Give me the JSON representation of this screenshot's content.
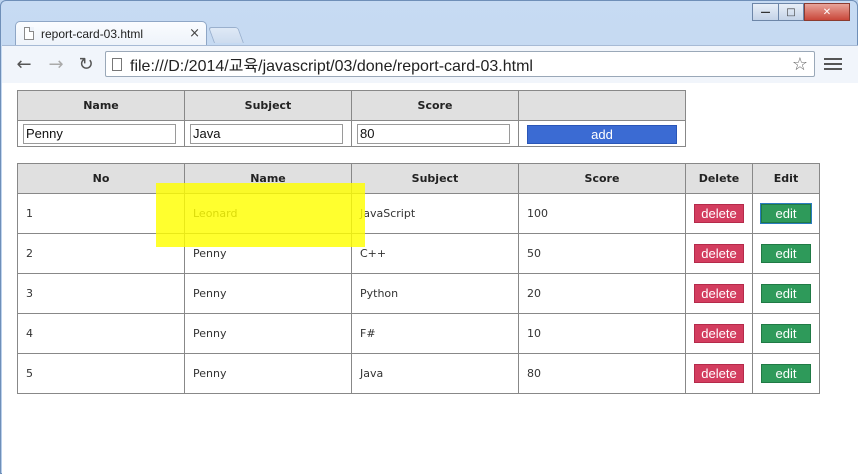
{
  "browser": {
    "tab_title": "report-card-03.html",
    "tab_close": "×",
    "url": "file:///D:/2014/교육/javascript/03/done/report-card-03.html",
    "win_min": "—",
    "win_max": "□",
    "win_close": "✕",
    "back": "←",
    "forward": "→",
    "reload": "↻",
    "star": "☆"
  },
  "form": {
    "headers": {
      "name": "Name",
      "subject": "Subject",
      "score": "Score"
    },
    "values": {
      "name": "Penny",
      "subject": "Java",
      "score": "80"
    },
    "add_label": "add"
  },
  "table": {
    "headers": {
      "no": "No",
      "name": "Name",
      "subject": "Subject",
      "score": "Score",
      "delete": "Delete",
      "edit": "Edit"
    },
    "delete_label": "delete",
    "edit_label": "edit",
    "rows": [
      {
        "no": "1",
        "name": "Leonard",
        "subject": "JavaScript",
        "score": "100"
      },
      {
        "no": "2",
        "name": "Penny",
        "subject": "C++",
        "score": "50"
      },
      {
        "no": "3",
        "name": "Penny",
        "subject": "Python",
        "score": "20"
      },
      {
        "no": "4",
        "name": "Penny",
        "subject": "F#",
        "score": "10"
      },
      {
        "no": "5",
        "name": "Penny",
        "subject": "Java",
        "score": "80"
      }
    ]
  },
  "colors": {
    "add": "#3b6bd3",
    "delete": "#d33d5f",
    "edit": "#2e9a5a",
    "highlight": "#ffff00"
  }
}
